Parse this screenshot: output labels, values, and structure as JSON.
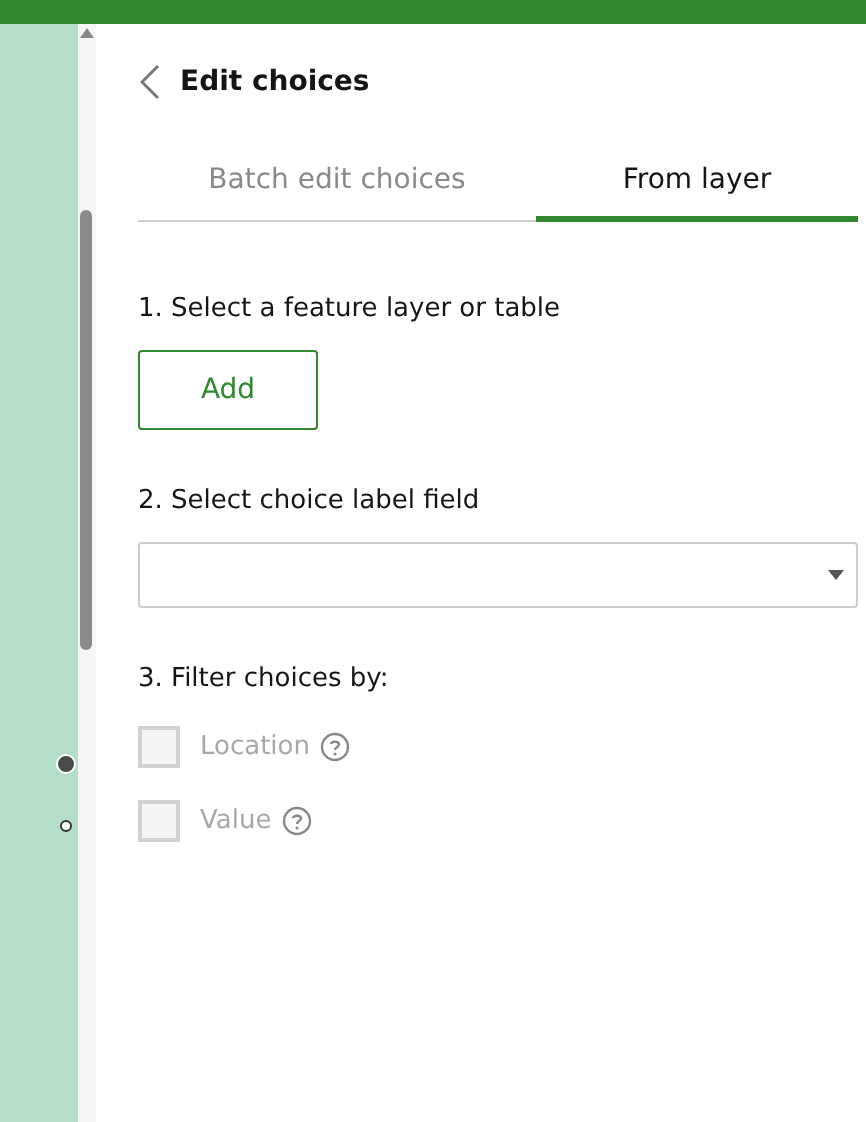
{
  "header": {
    "title": "Edit choices"
  },
  "tabs": [
    {
      "label": "Batch edit choices",
      "selected": false
    },
    {
      "label": "From layer",
      "selected": true
    }
  ],
  "steps": [
    {
      "kind": "button",
      "label": "1. Select a feature layer or table",
      "button": "Add"
    },
    {
      "kind": "select",
      "label": "2. Select choice label field"
    },
    {
      "kind": "checks",
      "label": "3. Filter choices by:",
      "options": [
        {
          "label": "Location",
          "checked": false,
          "disabled": true
        },
        {
          "label": "Value",
          "checked": false,
          "disabled": true
        }
      ]
    }
  ]
}
